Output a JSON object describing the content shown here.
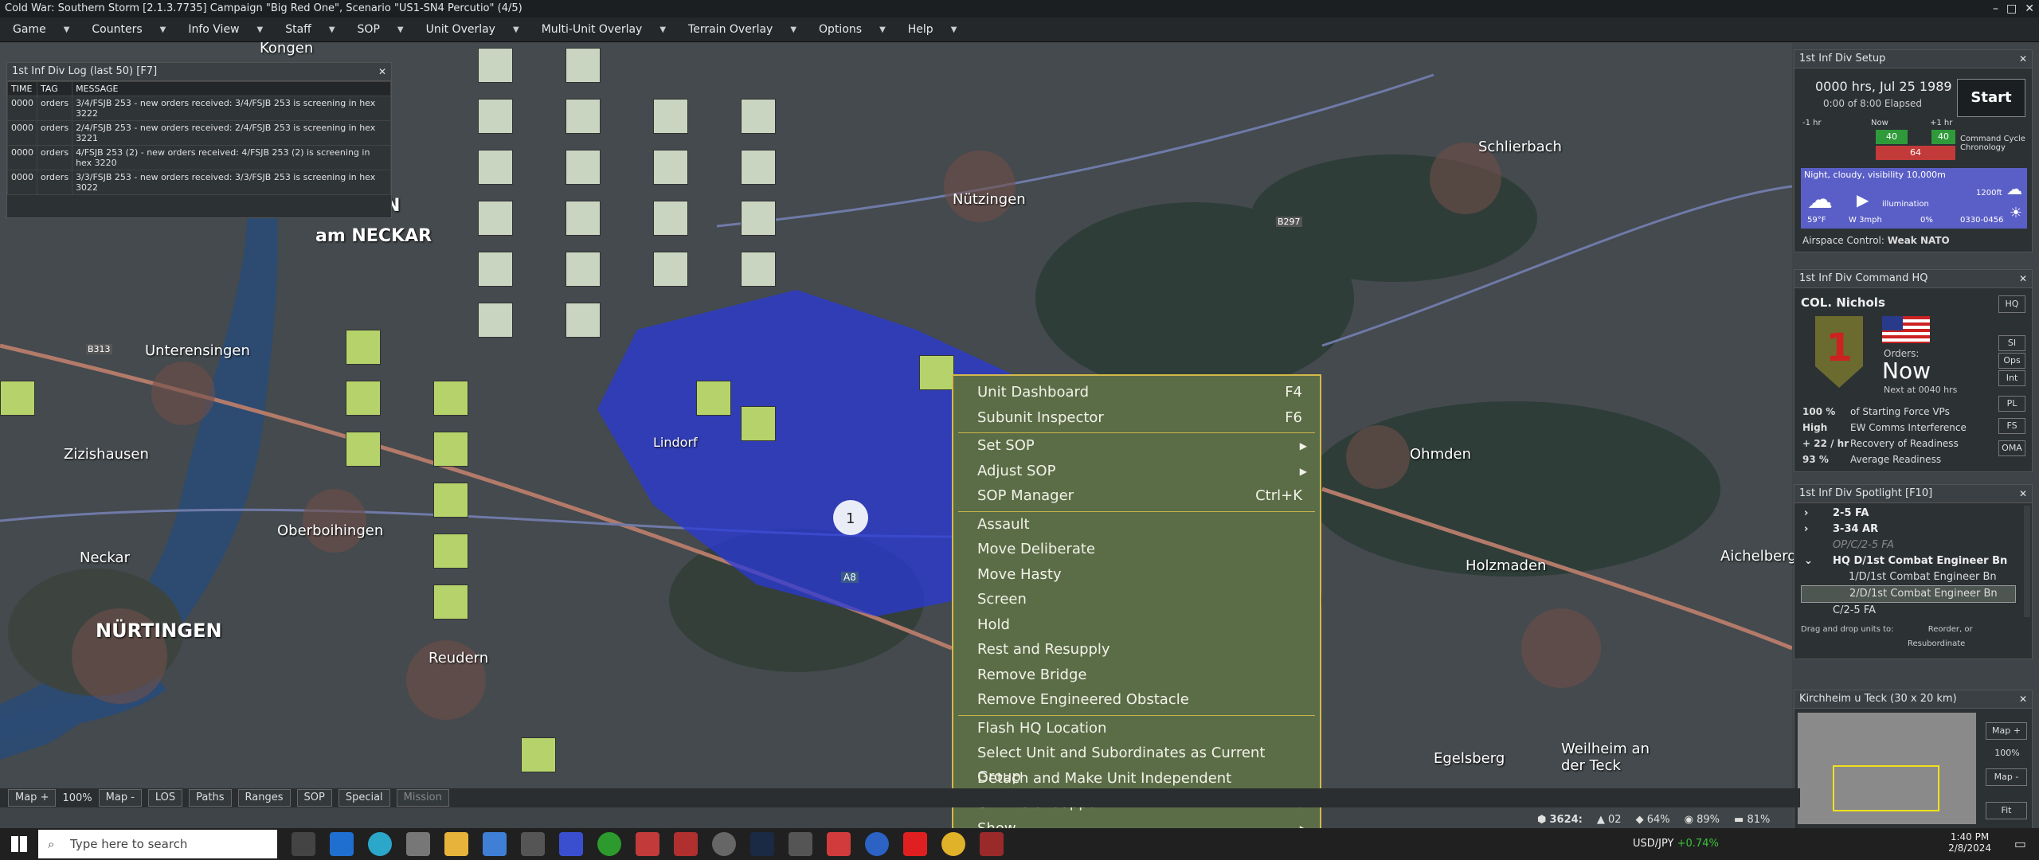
{
  "title_bar": {
    "text": "Cold War: Southern Storm  [2.1.3.7735]  Campaign \"Big Red One\", Scenario \"US1-SN4 Percutio\" (4/5)",
    "min_icon": "minimize-icon",
    "max_icon": "maximize-icon",
    "close_icon": "close-icon"
  },
  "menu": [
    "Game",
    "Counters",
    "Info View",
    "Staff",
    "SOP",
    "Unit Overlay",
    "Multi-Unit Overlay",
    "Terrain Overlay",
    "Options",
    "Help"
  ],
  "log_panel": {
    "title": "1st Inf Div Log (last 50)   [F7]",
    "columns": [
      "TIME",
      "TAG",
      "MESSAGE"
    ],
    "rows": [
      [
        "0000",
        "orders",
        "3/4/FSJB 253 - new orders received: 3/4/FSJB 253 is screening in hex 3222"
      ],
      [
        "0000",
        "orders",
        "2/4/FSJB 253 - new orders received: 2/4/FSJB 253 is screening in hex 3221"
      ],
      [
        "0000",
        "orders",
        "4/FSJB 253 (2) - new orders received: 4/FSJB 253 (2) is screening in hex 3220"
      ],
      [
        "0000",
        "orders",
        "3/3/FSJB 253 - new orders received: 3/3/FSJB 253 is screening in hex 3022"
      ]
    ]
  },
  "setup_panel": {
    "title": "1st Inf Div Setup",
    "datetime": "0000 hrs, Jul 25 1989",
    "elapsed": "0:00 of 8:00 Elapsed",
    "start": "Start",
    "timeline": [
      "-1 hr",
      "Now",
      "+1 hr"
    ],
    "bar_values": [
      "40",
      "40",
      "64"
    ],
    "cc_label": "Command Cycle Chronology",
    "weather": "Night, cloudy, visibility 10,000m",
    "ceiling": "1200ft",
    "illumination": "illumination",
    "temp": "59°F",
    "wind": "W 3mph",
    "precip": "0%",
    "times": "0330-0456",
    "airspace_label": "Airspace Control:",
    "airspace_value": "Weak NATO"
  },
  "hq_panel": {
    "title": "1st Inf Div Command HQ",
    "commander": "COL. Nichols",
    "orders_label": "Orders:",
    "orders_value": "Now",
    "next": "Next at 0040 hrs",
    "buttons": [
      "HQ",
      "SI",
      "Ops",
      "Int",
      "PL",
      "FS",
      "OMA"
    ],
    "stats": [
      [
        "100 %",
        "of Starting Force VPs"
      ],
      [
        "High",
        "EW Comms Interference"
      ],
      [
        "+ 22 / hr",
        "Recovery of Readiness"
      ],
      [
        "93 %",
        "Average Readiness"
      ]
    ]
  },
  "spotlight_panel": {
    "title": "1st Inf Div Spotlight  [F10]",
    "items": [
      "2-5 FA",
      "3-34 AR",
      "OP/C/2-5 FA",
      "HQ D/1st Combat Engineer Bn",
      "1/D/1st Combat Engineer Bn",
      "2/D/1st Combat Engineer Bn",
      "C/2-5 FA"
    ],
    "hint1": "Drag and drop units to:",
    "hint2": "Reorder, or",
    "hint3": "Resubordinate"
  },
  "minimap_panel": {
    "title": "Kirchheim u Teck (30 x 20 km)",
    "buttons": [
      "Map +",
      "100%",
      "Map -",
      "Fit"
    ]
  },
  "context_menu": [
    {
      "label": "Unit Dashboard",
      "shortcut": "F4"
    },
    {
      "label": "Subunit Inspector",
      "shortcut": "F6"
    },
    {
      "sep": true
    },
    {
      "label": "Set SOP",
      "submenu": true
    },
    {
      "label": "Adjust SOP",
      "submenu": true
    },
    {
      "label": "SOP Manager",
      "shortcut": "Ctrl+K"
    },
    {
      "sep": true
    },
    {
      "label": "Assault"
    },
    {
      "label": "Move Deliberate"
    },
    {
      "label": "Move Hasty"
    },
    {
      "label": "Screen"
    },
    {
      "label": "Hold"
    },
    {
      "label": "Rest and Resupply"
    },
    {
      "label": "Remove Bridge"
    },
    {
      "label": "Remove Engineered Obstacle"
    },
    {
      "sep": true
    },
    {
      "label": "Flash HQ Location"
    },
    {
      "label": "Select Unit and Subordinates as Current Group"
    },
    {
      "label": "Detach and Make Unit Independent"
    },
    {
      "label": "Unit Role: Support",
      "submenu": true
    },
    {
      "label": "Show",
      "submenu": true
    }
  ],
  "map_labels": [
    {
      "t": "NÜRTINGEN",
      "name": "town-nurtingen"
    },
    {
      "t": "Unterensingen",
      "name": "town-unterensingen"
    },
    {
      "t": "Zizishausen",
      "name": "town-zizishausen"
    },
    {
      "t": "Oberboihingen",
      "name": "town-oberboihingen"
    },
    {
      "t": "Reudern",
      "name": "town-reudern"
    },
    {
      "t": "Lindorf",
      "name": "town-lindorf"
    },
    {
      "t": "Nützingen",
      "name": "town-notzingen"
    },
    {
      "t": "Schlierbach",
      "name": "town-schlierbach"
    },
    {
      "t": "Ohmden",
      "name": "town-ohmden"
    },
    {
      "t": "Holzmaden",
      "name": "town-holzmaden"
    },
    {
      "t": "Aichelberg",
      "name": "town-aichelberg"
    },
    {
      "t": "Egelsberg",
      "name": "town-egelsberg"
    },
    {
      "t": "Weilheim an der Teck",
      "name": "town-weilheim"
    },
    {
      "t": "Neckar",
      "name": "river-neckar"
    },
    {
      "t": "B297",
      "name": "road-b297"
    },
    {
      "t": "A8",
      "name": "road-a8"
    },
    {
      "t": "B313",
      "name": "road-b313"
    },
    {
      "t": "Kongen",
      "name": "town-kongen"
    }
  ],
  "map_bottom_bar": [
    "Map +",
    "100%",
    "Map -",
    "LOS",
    "Paths",
    "Ranges",
    "SOP",
    "Special",
    "Mission"
  ],
  "status": {
    "vp": "3624:",
    "a": "02",
    "b": "64%",
    "c": "89%",
    "d": "81%"
  },
  "taskbar": {
    "search": "Type here to search",
    "ticker": "USD/JPY",
    "ticker_val": "+0.74%",
    "time": "1:40 PM",
    "date": "2/8/2024"
  },
  "colors": {
    "menu_bg": "#5b6d47",
    "menu_border": "#d4b94a",
    "hex_blue": "#2a3ad8"
  }
}
